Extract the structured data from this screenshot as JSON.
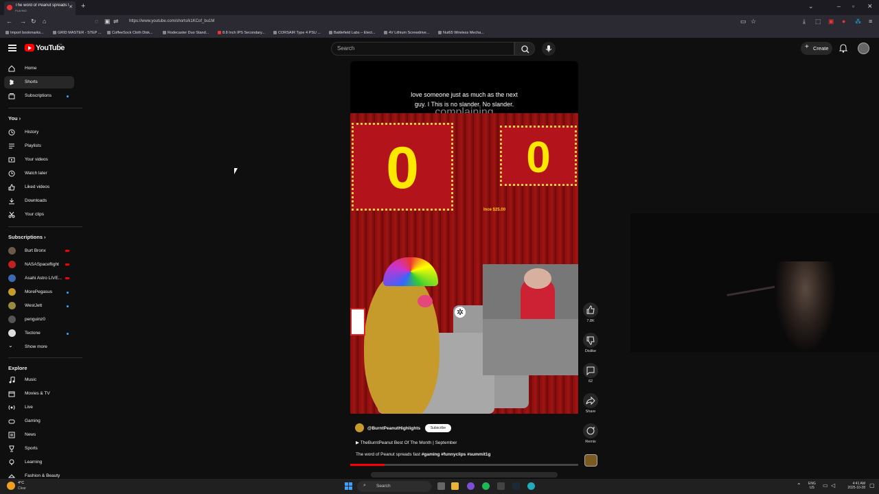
{
  "browser": {
    "tab_title": "The word of Peanut spreads fa",
    "tab_status": "PLAYING",
    "url": "https://www.youtube.com/shorts/k1KCof_bu1M",
    "bookmarks": [
      "Import bookmarks...",
      "GRID MASTER - STEP ...",
      "CoffeeSock Cloth Disk...",
      "Rodecaster Duo Stand...",
      "8.8 Inch IPS Secondary...",
      "CORSAIR Type 4 PSU ...",
      "Battlefield Labs – Elect...",
      "4V Lithium Screwdrive...",
      "Nut65 Wireless Mecha..."
    ]
  },
  "header": {
    "logo": "YouTube",
    "country": "CA",
    "search_placeholder": "Search",
    "create_label": "Create"
  },
  "sidebar": {
    "main": [
      {
        "label": "Home",
        "icon": "home-icon"
      },
      {
        "label": "Shorts",
        "icon": "shorts-icon",
        "active": true
      },
      {
        "label": "Subscriptions",
        "icon": "subscriptions-icon"
      }
    ],
    "you_heading": "You",
    "you": [
      {
        "label": "History",
        "icon": "history-icon"
      },
      {
        "label": "Playlists",
        "icon": "playlists-icon"
      },
      {
        "label": "Your videos",
        "icon": "your-videos-icon"
      },
      {
        "label": "Watch later",
        "icon": "watch-later-icon"
      },
      {
        "label": "Liked videos",
        "icon": "like-icon"
      },
      {
        "label": "Downloads",
        "icon": "download-icon"
      },
      {
        "label": "Your clips",
        "icon": "scissors-icon"
      }
    ],
    "subs_heading": "Subscriptions",
    "subs": [
      {
        "label": "Burt Bronx",
        "color": "#6b5a4a",
        "badge": "live"
      },
      {
        "label": "NASASpaceflight",
        "color": "#c02020",
        "badge": "live"
      },
      {
        "label": "Asahi Astro LIVE...",
        "color": "#3a6ab0",
        "badge": "live"
      },
      {
        "label": "MorePegasus",
        "color": "#c79a2c",
        "badge": "dot"
      },
      {
        "label": "WestJett",
        "color": "#9a8a40",
        "badge": "dot"
      },
      {
        "label": "penguinz0",
        "color": "#555555",
        "badge": ""
      },
      {
        "label": "Tectone",
        "color": "#dddddd",
        "badge": "dot"
      }
    ],
    "show_more": "Show more",
    "explore_heading": "Explore",
    "explore": [
      {
        "label": "Music",
        "icon": "music-icon"
      },
      {
        "label": "Movies & TV",
        "icon": "movies-icon"
      },
      {
        "label": "Live",
        "icon": "live-icon"
      },
      {
        "label": "Gaming",
        "icon": "gaming-icon"
      },
      {
        "label": "News",
        "icon": "news-icon"
      },
      {
        "label": "Sports",
        "icon": "trophy-icon"
      },
      {
        "label": "Learning",
        "icon": "learning-icon"
      },
      {
        "label": "Fashion & Beauty",
        "icon": "fashion-icon"
      }
    ]
  },
  "short": {
    "caption_line1": "love someone just as much as the next",
    "caption_line2": "guy. I This is no slander. No slander.",
    "background_text": "complaining",
    "score_left": "0",
    "score_right": "0",
    "price_tag": "Ince $25.00",
    "channel": "@BurntPeanutHighlights",
    "subscribe": "Subscribe",
    "playlist": "TheBurntPeanut Best Of The Month | September",
    "title_plain": "The word of Peanut spreads fast ",
    "title_tags": "#gaming #funnyclips #summit1g",
    "progress": 0.15
  },
  "actions": [
    {
      "name": "like",
      "label": "7.8K",
      "icon": "thumbs-up-icon"
    },
    {
      "name": "dislike",
      "label": "Dislike",
      "icon": "thumbs-down-icon"
    },
    {
      "name": "comments",
      "label": "62",
      "icon": "comment-icon"
    },
    {
      "name": "share",
      "label": "Share",
      "icon": "share-icon"
    },
    {
      "name": "remix",
      "label": "Remix",
      "icon": "remix-icon"
    }
  ],
  "taskbar": {
    "weather_temp": "4°C",
    "weather_desc": "Clear",
    "search": "Search",
    "lang1": "ENG",
    "lang2": "US",
    "time": "4:41 AM",
    "date": "2025-10-28"
  }
}
